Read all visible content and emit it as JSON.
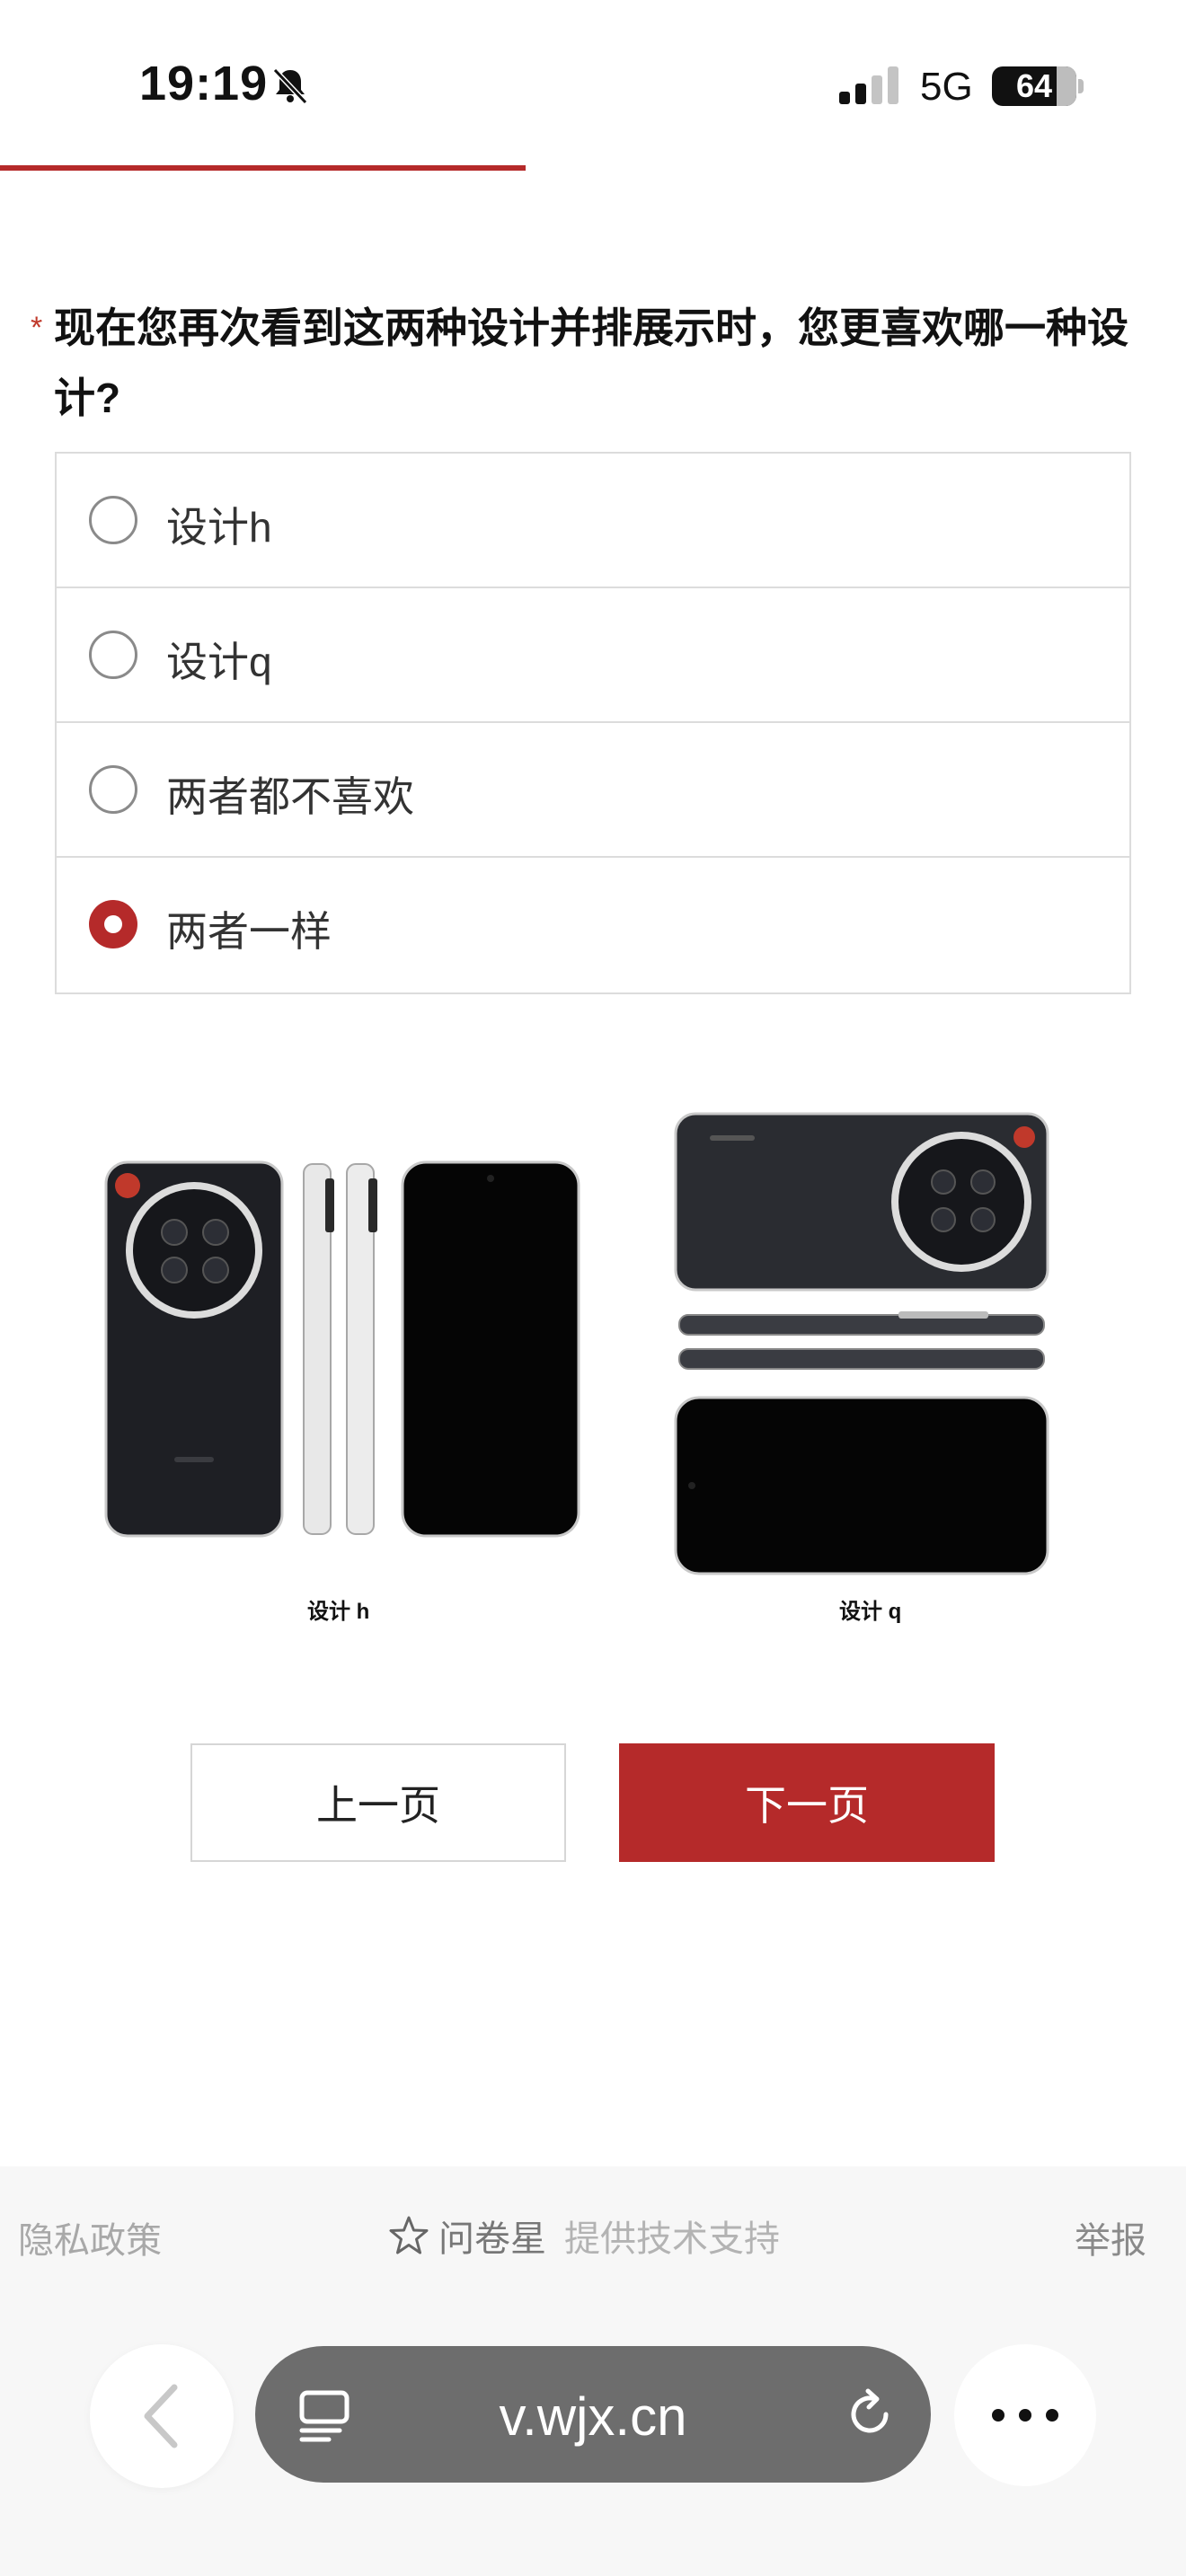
{
  "status_bar": {
    "time": "19:19",
    "network": "5G",
    "battery": "64",
    "icons": [
      "bell-muted-icon",
      "signal-icon"
    ]
  },
  "progress": {
    "fraction": 0.443,
    "color": "#b52a2a"
  },
  "question": {
    "required_mark": "*",
    "title": "现在您再次看到这两种设计并排展示时，您更喜欢哪一种设计?",
    "options": [
      {
        "label": "设计h",
        "selected": false
      },
      {
        "label": "设计q",
        "selected": false
      },
      {
        "label": "两者都不喜欢",
        "selected": false
      },
      {
        "label": "两者一样",
        "selected": true
      }
    ]
  },
  "figure": {
    "caption_h": "设计 h",
    "caption_q": "设计 q"
  },
  "nav": {
    "prev_label": "上一页",
    "next_label": "下一页",
    "accent": "#b52a2a"
  },
  "footer": {
    "privacy": "隐私政策",
    "brand": "问卷星",
    "support": "提供技术支持",
    "report": "举报"
  },
  "browser": {
    "url": "v.wjx.cn",
    "icons": [
      "chevron-left-icon",
      "reader-icon",
      "reload-icon",
      "more-icon"
    ]
  }
}
